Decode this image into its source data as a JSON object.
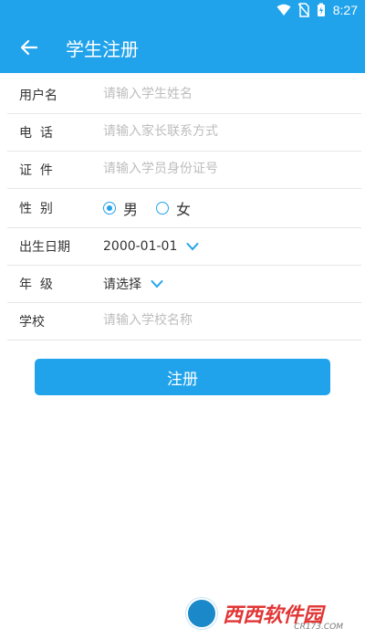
{
  "status_bar": {
    "time": "8:27",
    "wifi_icon": "wifi-icon",
    "sim_icon": "sim-off-icon",
    "battery_icon": "battery-charging-icon"
  },
  "app_bar": {
    "title": "学生注册",
    "back_icon": "arrow-left-icon"
  },
  "form": {
    "name": {
      "label": "用户名",
      "placeholder": "请输入学生姓名",
      "value": ""
    },
    "phone": {
      "label": "电  话",
      "placeholder": "请输入家长联系方式",
      "value": ""
    },
    "id_card": {
      "label": "证  件",
      "placeholder": "请输入学员身份证号",
      "value": ""
    },
    "gender": {
      "label": "性  别",
      "options": [
        "男",
        "女"
      ],
      "selected": "男"
    },
    "birthdate": {
      "label": "出生日期",
      "value": "2000-01-01"
    },
    "grade": {
      "label": "年  级",
      "value": "请选择"
    },
    "school": {
      "label": "学校",
      "placeholder": "请输入学校名称",
      "value": ""
    }
  },
  "submit_button": {
    "label": "注册"
  },
  "watermark": {
    "text": "西西软件园",
    "sub": "CR173.COM"
  },
  "colors": {
    "primary": "#21a3ec",
    "placeholder": "#bdbdbd",
    "divider": "#e6e6e6"
  }
}
